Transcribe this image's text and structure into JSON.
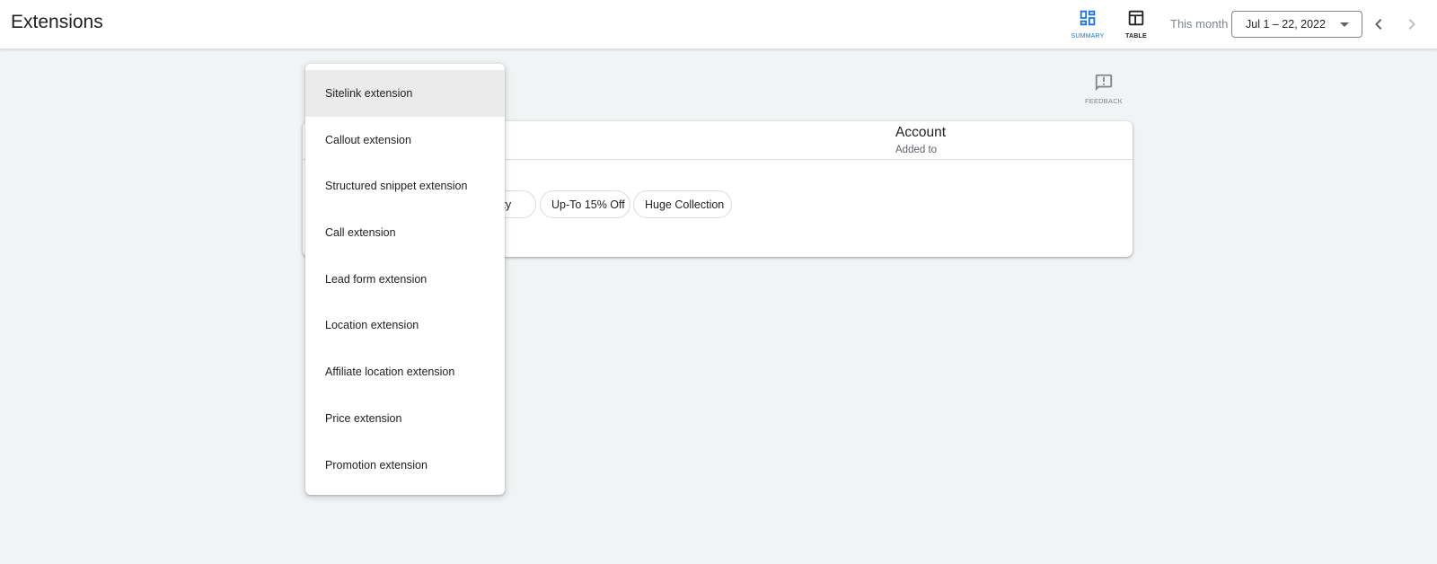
{
  "header": {
    "title": "Extensions",
    "views": [
      {
        "label": "SUMMARY",
        "icon": "dashboard-icon",
        "active": true
      },
      {
        "label": "TABLE",
        "icon": "table-icon",
        "active": false
      }
    ],
    "period_label": "This month",
    "date_range": "Jul 1 – 22, 2022",
    "prev_icon": "chevron-left-icon",
    "next_icon": "chevron-right-icon"
  },
  "feedback": {
    "label": "FEEDBACK",
    "icon": "feedback-icon"
  },
  "card": {
    "column_title": "Account",
    "column_subtitle": "Added to",
    "chips": [
      "uality",
      "Up-To 15% Off",
      "Huge Collection"
    ]
  },
  "menu": {
    "items": [
      {
        "label": "Sitelink extension",
        "active": true
      },
      {
        "label": "Callout extension"
      },
      {
        "label": "Structured snippet extension"
      },
      {
        "label": "Call extension"
      },
      {
        "label": "Lead form extension"
      },
      {
        "label": "Location extension"
      },
      {
        "label": "Affiliate location extension"
      },
      {
        "label": "Price extension"
      },
      {
        "label": "Promotion extension"
      }
    ]
  },
  "colors": {
    "accent": "#1a73e8",
    "background": "#f1f3f4",
    "menu_active": "#ebebeb"
  }
}
